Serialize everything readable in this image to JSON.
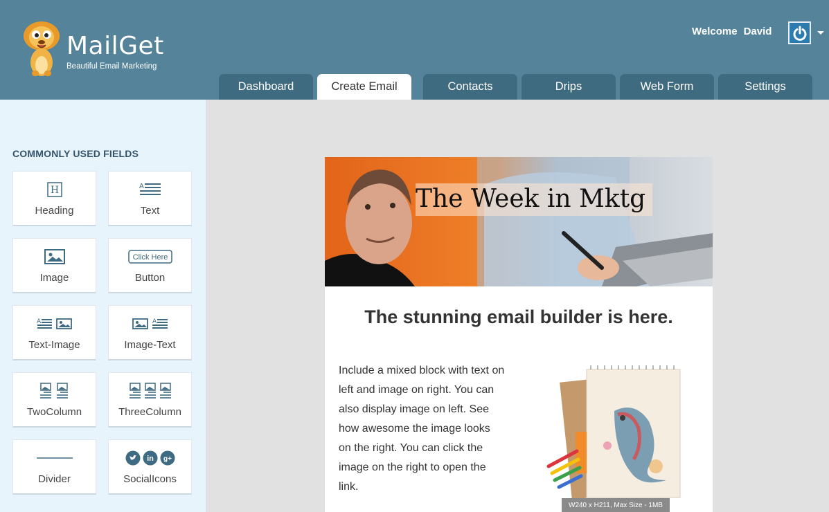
{
  "brand": {
    "name": "MailGet",
    "tagline": "Beautiful Email Marketing"
  },
  "user": {
    "welcome": "Welcome",
    "name": "David"
  },
  "tabs": [
    {
      "label": "Dashboard"
    },
    {
      "label": "Create Email",
      "active": true
    },
    {
      "label": "Contacts"
    },
    {
      "label": "Drips"
    },
    {
      "label": "Web Form"
    },
    {
      "label": "Settings"
    }
  ],
  "sidebar": {
    "title": "COMMONLY USED FIELDS",
    "fields": [
      {
        "label": "Heading",
        "icon": "heading-icon"
      },
      {
        "label": "Text",
        "icon": "text-icon"
      },
      {
        "label": "Image",
        "icon": "image-icon"
      },
      {
        "label": "Button",
        "icon": "button-icon",
        "icon_text": "Click Here"
      },
      {
        "label": "Text-Image",
        "icon": "text-image-icon"
      },
      {
        "label": "Image-Text",
        "icon": "image-text-icon"
      },
      {
        "label": "TwoColumn",
        "icon": "two-column-icon"
      },
      {
        "label": "ThreeColumn",
        "icon": "three-column-icon"
      },
      {
        "label": "Divider",
        "icon": "divider-icon"
      },
      {
        "label": "SocialIcons",
        "icon": "social-icons-icon"
      }
    ]
  },
  "email": {
    "banner_title": "The Week in Mktg",
    "headline": "The stunning email builder is here.",
    "body": "Include a mixed block with text on left and image on right. You can also display image on left. See how awesome the image looks on the right. You can click the image on the right to open the link.",
    "image_size_note": "W240 x H211, Max Size - 1MB"
  },
  "colors": {
    "header": "#558399",
    "tab": "#3f6b80",
    "sidebar": "#e8f4fc",
    "canvas": "#e1e1e1",
    "accent": "#2c7bb0",
    "icon": "#3e6a82"
  }
}
